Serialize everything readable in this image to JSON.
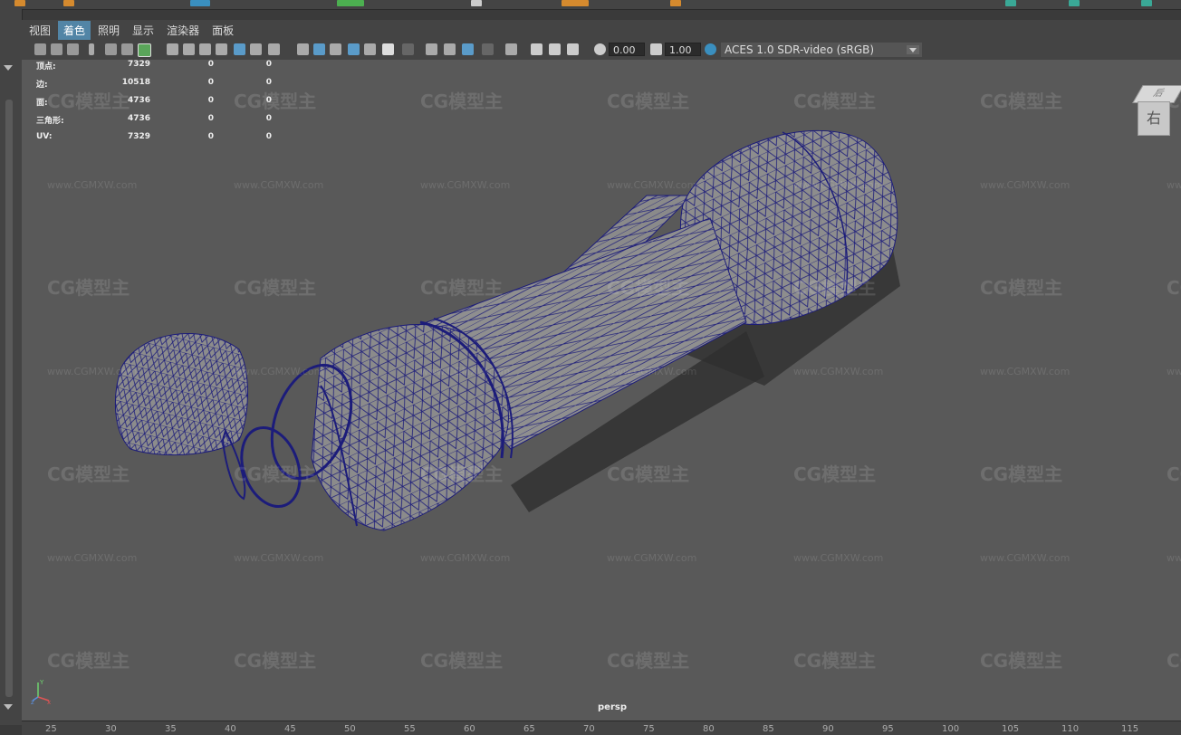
{
  "menu": {
    "items": [
      "视图",
      "着色",
      "照明",
      "显示",
      "渲染器",
      "面板"
    ],
    "active_index": 1
  },
  "toolbar": {
    "field1": "0.00",
    "field2": "1.00",
    "colorspace": "ACES 1.0 SDR-video (sRGB)"
  },
  "hud": {
    "rows": [
      {
        "label": "顶点:",
        "v1": "7329",
        "v2": "0",
        "v3": "0"
      },
      {
        "label": "边:",
        "v1": "10518",
        "v2": "0",
        "v3": "0"
      },
      {
        "label": "面:",
        "v1": "4736",
        "v2": "0",
        "v3": "0"
      },
      {
        "label": "三角形:",
        "v1": "4736",
        "v2": "0",
        "v3": "0"
      },
      {
        "label": "UV:",
        "v1": "7329",
        "v2": "0",
        "v3": "0"
      }
    ]
  },
  "viewport": {
    "camera": "persp",
    "viewcube_label": "右",
    "viewcube_top": "后"
  },
  "watermark": {
    "logo": "CG模型主",
    "url": "www.CGMXW.com"
  },
  "axis": {
    "x": "x",
    "y": "Y",
    "z": "z"
  },
  "ruler": {
    "ticks": [
      "25",
      "30",
      "35",
      "40",
      "45",
      "50",
      "55",
      "60",
      "65",
      "70",
      "75",
      "80",
      "85",
      "90",
      "95",
      "100",
      "105",
      "110",
      "115"
    ]
  },
  "colors": {
    "background": "#595959",
    "wire": "#1c1c7a",
    "accent": "#5285a6",
    "mesh_fill": "#8c8c8c"
  }
}
